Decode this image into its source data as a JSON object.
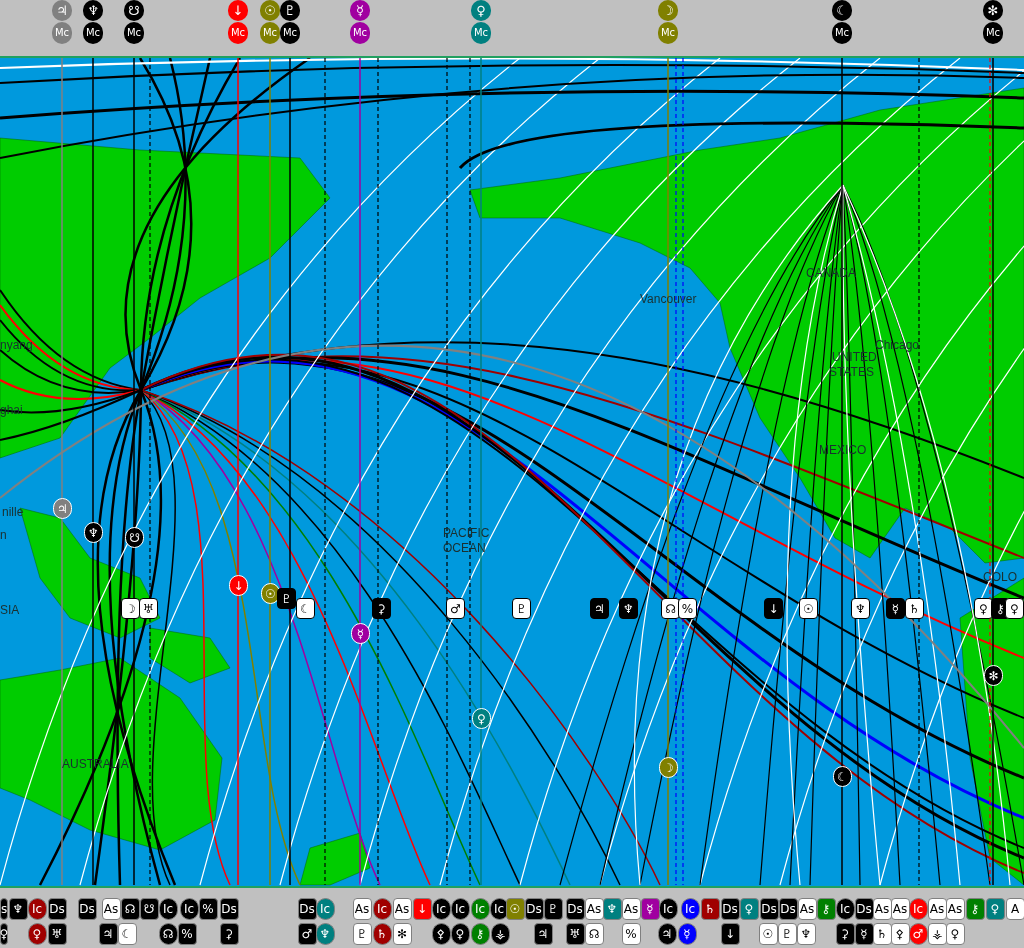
{
  "top_bar": {
    "markers": [
      {
        "glyph": "♃",
        "angle": "Mc",
        "color": "#808080"
      },
      {
        "glyph": "♆",
        "angle": "Mc",
        "color": "#000000"
      },
      {
        "glyph": "☋",
        "angle": "Mc",
        "color": "#000000"
      },
      {
        "glyph": "↓",
        "angle": "Mc",
        "color": "#ff0000"
      },
      {
        "glyph": "☉",
        "angle": "Mc",
        "color": "#808000"
      },
      {
        "glyph": "♇",
        "angle": "Mc",
        "color": "#000000"
      },
      {
        "glyph": "☿",
        "angle": "Mc",
        "color": "#a000a0"
      },
      {
        "glyph": "♀",
        "angle": "Mc",
        "color": "#008080"
      },
      {
        "glyph": "☽",
        "angle": "Mc",
        "color": "#808000"
      },
      {
        "glyph": "☾",
        "angle": "Mc",
        "color": "#000000"
      },
      {
        "glyph": "✻",
        "angle": "Mc",
        "color": "#000000"
      }
    ]
  },
  "map": {
    "labels": [
      {
        "text": "nyang"
      },
      {
        "text": "ghai"
      },
      {
        "text": "nille"
      },
      {
        "text": "n"
      },
      {
        "text": "SIA"
      },
      {
        "text": "AUSTRALIA"
      },
      {
        "text": "PACIFIC"
      },
      {
        "text": "OCEAN"
      },
      {
        "text": "Vancouver"
      },
      {
        "text": "CANADA"
      },
      {
        "text": "UNITED"
      },
      {
        "text": "STATES"
      },
      {
        "text": "Chicago"
      },
      {
        "text": "MEXICO"
      },
      {
        "text": "COLO"
      }
    ],
    "markers": [
      {
        "glyph": "♃",
        "color": "#808080",
        "kind": "round"
      },
      {
        "glyph": "♆",
        "color": "#000000",
        "kind": "round"
      },
      {
        "glyph": "☋",
        "color": "#000000",
        "kind": "round"
      },
      {
        "glyph": "↓",
        "color": "#ff0000",
        "kind": "round"
      },
      {
        "glyph": "☉",
        "color": "#808000",
        "kind": "round"
      },
      {
        "glyph": "☿",
        "color": "#a000a0",
        "kind": "round"
      },
      {
        "glyph": "♀",
        "color": "#008080",
        "kind": "round"
      },
      {
        "glyph": "☽",
        "color": "#808000",
        "kind": "round"
      },
      {
        "glyph": "☾",
        "color": "#000000",
        "kind": "round"
      },
      {
        "glyph": "✻",
        "color": "#000000",
        "kind": "round"
      },
      {
        "glyph": "☽",
        "color": "#ffffff",
        "kind": "square"
      },
      {
        "glyph": "♅",
        "color": "#ffffff",
        "kind": "square"
      },
      {
        "glyph": "♇",
        "color": "#000000",
        "kind": "square"
      },
      {
        "glyph": "☾",
        "color": "#ffffff",
        "kind": "square"
      },
      {
        "glyph": "⚳",
        "color": "#000000",
        "kind": "square"
      },
      {
        "glyph": "♂",
        "color": "#ffffff",
        "kind": "square"
      },
      {
        "glyph": "♇",
        "color": "#ffffff",
        "kind": "square"
      },
      {
        "glyph": "♃",
        "color": "#000000",
        "kind": "square"
      },
      {
        "glyph": "♆",
        "color": "#000000",
        "kind": "square"
      },
      {
        "glyph": "☊",
        "color": "#ffffff",
        "kind": "square"
      },
      {
        "glyph": "%",
        "color": "#ffffff",
        "kind": "square"
      },
      {
        "glyph": "↓",
        "color": "#000000",
        "kind": "square"
      },
      {
        "glyph": "☉",
        "color": "#ffffff",
        "kind": "square"
      },
      {
        "glyph": "♆",
        "color": "#ffffff",
        "kind": "square"
      },
      {
        "glyph": "☿",
        "color": "#000000",
        "kind": "square"
      },
      {
        "glyph": "♄",
        "color": "#ffffff",
        "kind": "square"
      },
      {
        "glyph": "♀",
        "color": "#ffffff",
        "kind": "square"
      },
      {
        "glyph": "⚷",
        "color": "#000000",
        "kind": "square"
      },
      {
        "glyph": "♀",
        "color": "#ffffff",
        "kind": "square"
      }
    ]
  },
  "bottom_bar": {
    "upper": [
      {
        "text": "s",
        "color": "#000000",
        "kind": "square"
      },
      {
        "text": "♆",
        "color": "#000000",
        "kind": "square"
      },
      {
        "text": "Ic",
        "color": "#a00000",
        "kind": "round"
      },
      {
        "text": "Ds",
        "color": "#000000",
        "kind": "square"
      },
      {
        "text": "Ds",
        "color": "#000000",
        "kind": "square"
      },
      {
        "text": "As",
        "color": "#ffffff",
        "kind": "square"
      },
      {
        "text": "☊",
        "color": "#000000",
        "kind": "square"
      },
      {
        "text": "☋",
        "color": "#000000",
        "kind": "square"
      },
      {
        "text": "Ic",
        "color": "#000000",
        "kind": "round"
      },
      {
        "text": "Ic",
        "color": "#000000",
        "kind": "round"
      },
      {
        "text": "%",
        "color": "#000000",
        "kind": "square"
      },
      {
        "text": "Ds",
        "color": "#000000",
        "kind": "square"
      },
      {
        "text": "Ds",
        "color": "#000000",
        "kind": "square"
      },
      {
        "text": "Ic",
        "color": "#008080",
        "kind": "round"
      },
      {
        "text": "As",
        "color": "#ffffff",
        "kind": "square"
      },
      {
        "text": "Ic",
        "color": "#a00000",
        "kind": "round"
      },
      {
        "text": "As",
        "color": "#ffffff",
        "kind": "square"
      },
      {
        "text": "↓",
        "color": "#ff0000",
        "kind": "square"
      },
      {
        "text": "Ic",
        "color": "#000000",
        "kind": "round"
      },
      {
        "text": "Ic",
        "color": "#000000",
        "kind": "round"
      },
      {
        "text": "Ic",
        "color": "#008000",
        "kind": "round"
      },
      {
        "text": "Ic",
        "color": "#000000",
        "kind": "round"
      },
      {
        "text": "☉",
        "color": "#808000",
        "kind": "square"
      },
      {
        "text": "Ds",
        "color": "#000000",
        "kind": "square"
      },
      {
        "text": "♇",
        "color": "#000000",
        "kind": "square"
      },
      {
        "text": "Ds",
        "color": "#000000",
        "kind": "square"
      },
      {
        "text": "As",
        "color": "#ffffff",
        "kind": "square"
      },
      {
        "text": "♆",
        "color": "#008080",
        "kind": "square"
      },
      {
        "text": "As",
        "color": "#ffffff",
        "kind": "square"
      },
      {
        "text": "☿",
        "color": "#a000a0",
        "kind": "square"
      },
      {
        "text": "Ic",
        "color": "#000000",
        "kind": "round"
      },
      {
        "text": "Ic",
        "color": "#0000ff",
        "kind": "round"
      },
      {
        "text": "♄",
        "color": "#a00000",
        "kind": "square"
      },
      {
        "text": "Ds",
        "color": "#000000",
        "kind": "square"
      },
      {
        "text": "♀",
        "color": "#008080",
        "kind": "square"
      },
      {
        "text": "Ds",
        "color": "#000000",
        "kind": "square"
      },
      {
        "text": "Ds",
        "color": "#000000",
        "kind": "square"
      },
      {
        "text": "As",
        "color": "#ffffff",
        "kind": "square"
      },
      {
        "text": "⚷",
        "color": "#008000",
        "kind": "square"
      },
      {
        "text": "Ic",
        "color": "#000000",
        "kind": "round"
      },
      {
        "text": "Ds",
        "color": "#000000",
        "kind": "square"
      },
      {
        "text": "As",
        "color": "#ffffff",
        "kind": "square"
      },
      {
        "text": "As",
        "color": "#ffffff",
        "kind": "square"
      },
      {
        "text": "Ic",
        "color": "#ff0000",
        "kind": "round"
      },
      {
        "text": "As",
        "color": "#ffffff",
        "kind": "square"
      },
      {
        "text": "As",
        "color": "#ffffff",
        "kind": "square"
      },
      {
        "text": "⚷",
        "color": "#008000",
        "kind": "square"
      },
      {
        "text": "♀",
        "color": "#008080",
        "kind": "square"
      },
      {
        "text": "A",
        "color": "#ffffff",
        "kind": "square"
      }
    ],
    "lower": [
      {
        "text": "♀",
        "color": "#000000",
        "kind": "square"
      },
      {
        "text": "♀",
        "color": "#a00000",
        "kind": "round"
      },
      {
        "text": "♅",
        "color": "#000000",
        "kind": "square"
      },
      {
        "text": "♃",
        "color": "#000000",
        "kind": "square"
      },
      {
        "text": "☾",
        "color": "#ffffff",
        "kind": "square"
      },
      {
        "text": "☊",
        "color": "#000000",
        "kind": "round"
      },
      {
        "text": "%",
        "color": "#000000",
        "kind": "square"
      },
      {
        "text": "⚳",
        "color": "#000000",
        "kind": "square"
      },
      {
        "text": "♂",
        "color": "#000000",
        "kind": "square"
      },
      {
        "text": "♆",
        "color": "#008080",
        "kind": "round"
      },
      {
        "text": "♇",
        "color": "#ffffff",
        "kind": "square"
      },
      {
        "text": "♄",
        "color": "#a00000",
        "kind": "round"
      },
      {
        "text": "✻",
        "color": "#ffffff",
        "kind": "square"
      },
      {
        "text": "⚴",
        "color": "#000000",
        "kind": "round"
      },
      {
        "text": "♀",
        "color": "#000000",
        "kind": "round"
      },
      {
        "text": "⚷",
        "color": "#008000",
        "kind": "round"
      },
      {
        "text": "⚶",
        "color": "#000000",
        "kind": "round"
      },
      {
        "text": "♃",
        "color": "#000000",
        "kind": "square"
      },
      {
        "text": "♅",
        "color": "#000000",
        "kind": "square"
      },
      {
        "text": "☊",
        "color": "#ffffff",
        "kind": "square"
      },
      {
        "text": "%",
        "color": "#ffffff",
        "kind": "square"
      },
      {
        "text": "♃",
        "color": "#000000",
        "kind": "round"
      },
      {
        "text": "☿",
        "color": "#0000ff",
        "kind": "round"
      },
      {
        "text": "↓",
        "color": "#000000",
        "kind": "square"
      },
      {
        "text": "☉",
        "color": "#ffffff",
        "kind": "square"
      },
      {
        "text": "♇",
        "color": "#ffffff",
        "kind": "square"
      },
      {
        "text": "♆",
        "color": "#ffffff",
        "kind": "square"
      },
      {
        "text": "⚳",
        "color": "#000000",
        "kind": "square"
      },
      {
        "text": "☿",
        "color": "#000000",
        "kind": "square"
      },
      {
        "text": "♄",
        "color": "#ffffff",
        "kind": "square"
      },
      {
        "text": "⚴",
        "color": "#ffffff",
        "kind": "square"
      },
      {
        "text": "♂",
        "color": "#ff0000",
        "kind": "round"
      },
      {
        "text": "⚶",
        "color": "#ffffff",
        "kind": "square"
      },
      {
        "text": "♀",
        "color": "#ffffff",
        "kind": "square"
      }
    ]
  }
}
